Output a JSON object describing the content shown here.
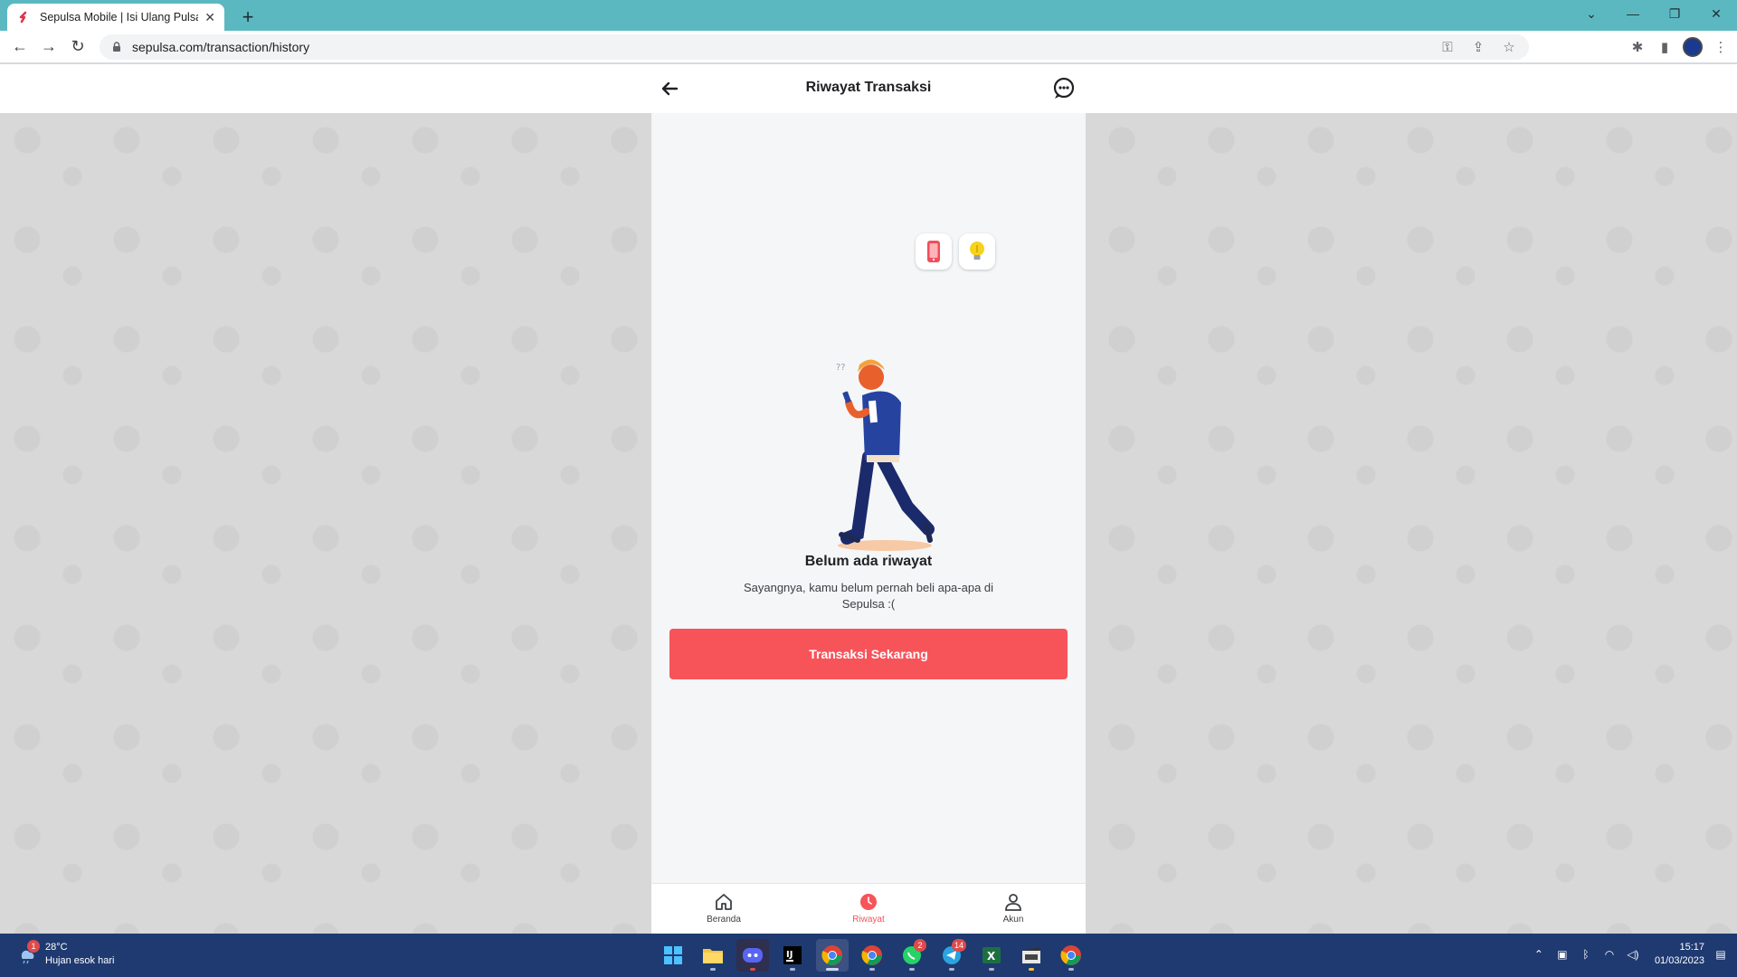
{
  "browser": {
    "tab_title": "Sepulsa Mobile | Isi Ulang Pulsa ...",
    "url": "sepulsa.com/transaction/history"
  },
  "header": {
    "title": "Riwayat Transaksi"
  },
  "empty_state": {
    "title": "Belum ada riwayat",
    "description": "Sayangnya, kamu belum pernah beli apa-apa di Sepulsa :(",
    "cta_label": "Transaksi Sekarang"
  },
  "bottom_nav": {
    "items": [
      {
        "label": "Beranda",
        "icon": "home-icon",
        "active": false
      },
      {
        "label": "Riwayat",
        "icon": "history-icon",
        "active": true
      },
      {
        "label": "Akun",
        "icon": "user-icon",
        "active": false
      }
    ]
  },
  "taskbar": {
    "weather_temp": "28°C",
    "weather_desc": "Hujan esok hari",
    "weather_badge": "1",
    "apps": [
      {
        "name": "windows-start-icon"
      },
      {
        "name": "file-explorer-icon"
      },
      {
        "name": "discord-icon"
      },
      {
        "name": "intellij-icon"
      },
      {
        "name": "chrome-icon",
        "active": true
      },
      {
        "name": "chrome-alt-icon"
      },
      {
        "name": "whatsapp-icon",
        "badge": "2"
      },
      {
        "name": "telegram-icon",
        "badge": "14"
      },
      {
        "name": "excel-icon"
      },
      {
        "name": "video-editor-icon"
      },
      {
        "name": "chrome-profile-icon"
      }
    ],
    "time": "15:17",
    "date": "01/03/2023"
  },
  "colors": {
    "brand": "#f7545a",
    "tabstrip": "#5bb8c1",
    "taskbar": "#1f3a70"
  }
}
